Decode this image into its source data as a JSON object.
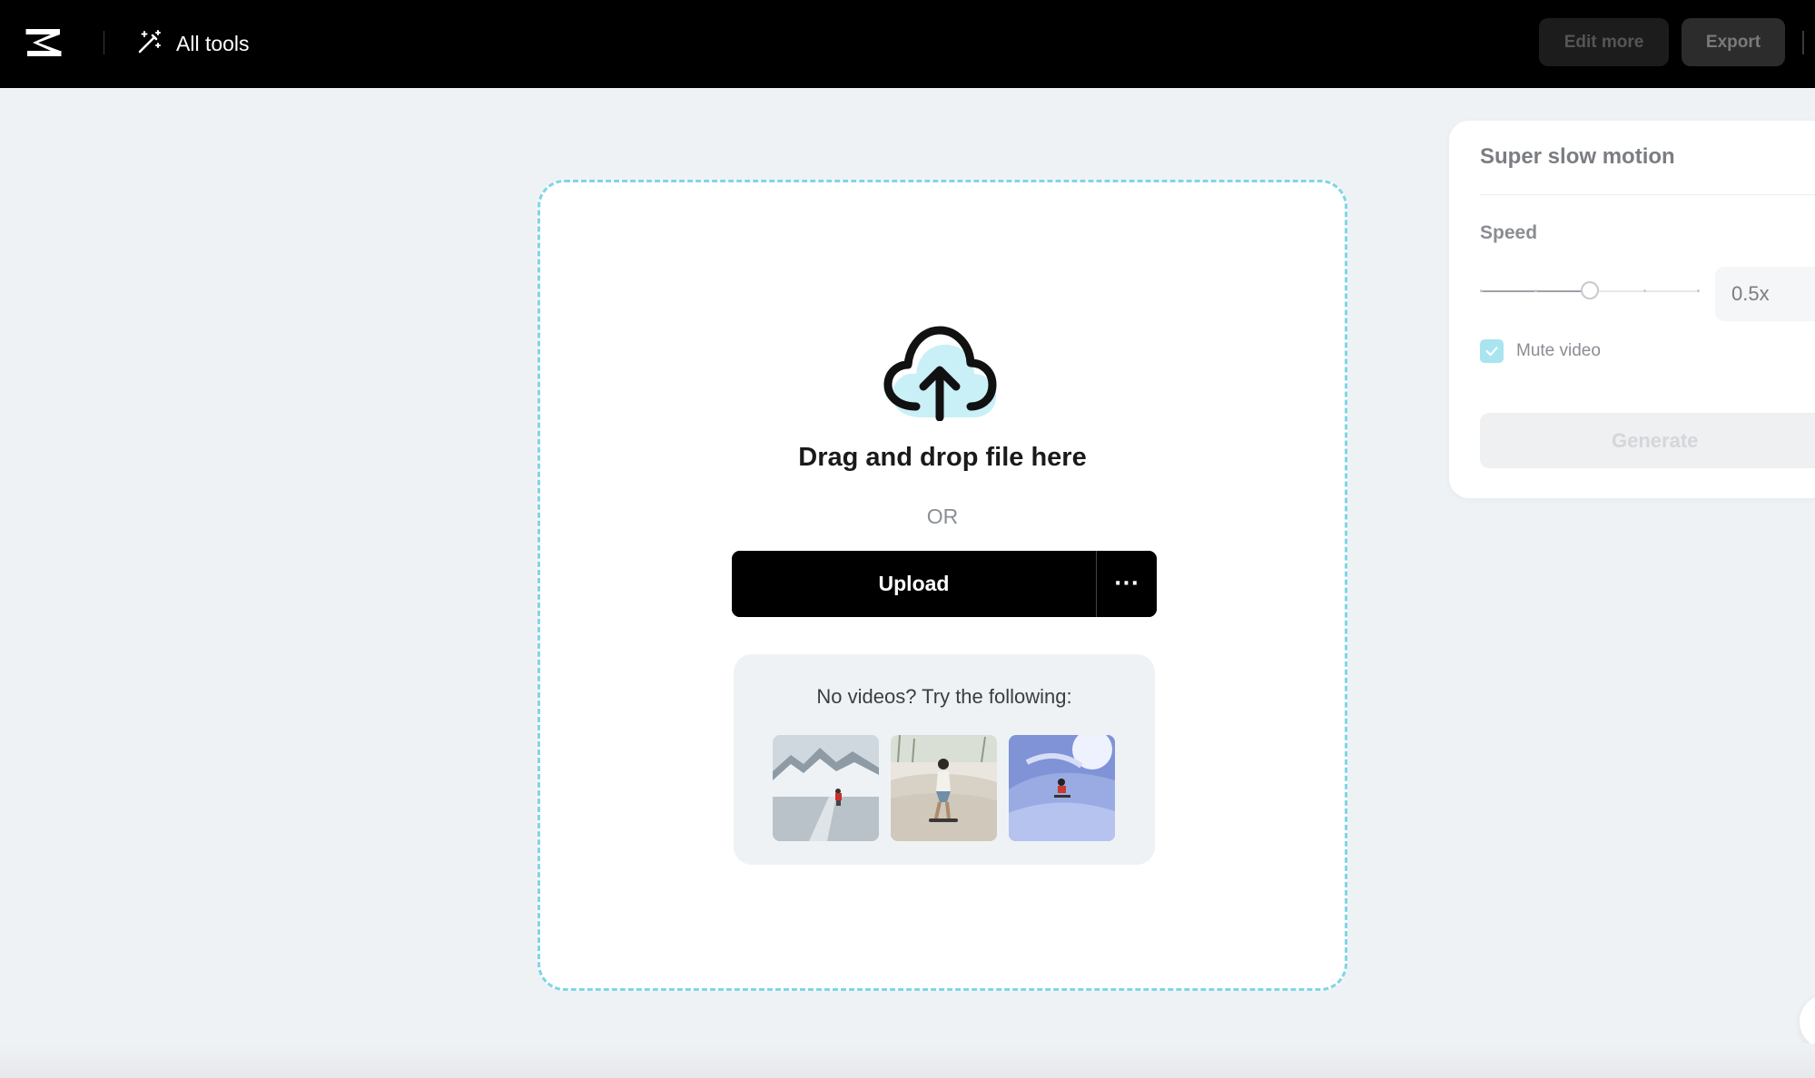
{
  "topbar": {
    "all_tools_label": "All tools",
    "edit_more_label": "Edit more",
    "export_label": "Export"
  },
  "icons": {
    "logo": "capcut-logo-icon",
    "all_tools": "magic-wand-icon",
    "upload": "cloud-upload-icon",
    "more": "more-horizontal-icon",
    "check": "check-icon"
  },
  "dropzone": {
    "title": "Drag and drop file here",
    "or_text": "OR",
    "upload_label": "Upload",
    "more_label": "···",
    "samples_title": "No videos? Try the following:"
  },
  "panel": {
    "title": "Super slow motion",
    "speed_label": "Speed",
    "speed_value": "0.5x",
    "slider_value": 0.5,
    "mute_label": "Mute video",
    "mute_checked": true,
    "generate_label": "Generate"
  },
  "colors": {
    "accent_cyan": "#7fd6e6",
    "checkbox": "#a9e5f0",
    "topbar": "#000000",
    "background": "#eff2f5"
  }
}
